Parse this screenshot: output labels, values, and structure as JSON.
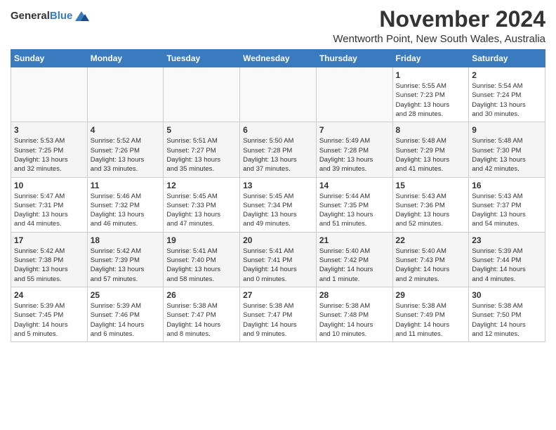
{
  "header": {
    "logo_general": "General",
    "logo_blue": "Blue",
    "month_title": "November 2024",
    "location": "Wentworth Point, New South Wales, Australia"
  },
  "days_of_week": [
    "Sunday",
    "Monday",
    "Tuesday",
    "Wednesday",
    "Thursday",
    "Friday",
    "Saturday"
  ],
  "weeks": [
    [
      {
        "day": "",
        "info": ""
      },
      {
        "day": "",
        "info": ""
      },
      {
        "day": "",
        "info": ""
      },
      {
        "day": "",
        "info": ""
      },
      {
        "day": "",
        "info": ""
      },
      {
        "day": "1",
        "info": "Sunrise: 5:55 AM\nSunset: 7:23 PM\nDaylight: 13 hours\nand 28 minutes."
      },
      {
        "day": "2",
        "info": "Sunrise: 5:54 AM\nSunset: 7:24 PM\nDaylight: 13 hours\nand 30 minutes."
      }
    ],
    [
      {
        "day": "3",
        "info": "Sunrise: 5:53 AM\nSunset: 7:25 PM\nDaylight: 13 hours\nand 32 minutes."
      },
      {
        "day": "4",
        "info": "Sunrise: 5:52 AM\nSunset: 7:26 PM\nDaylight: 13 hours\nand 33 minutes."
      },
      {
        "day": "5",
        "info": "Sunrise: 5:51 AM\nSunset: 7:27 PM\nDaylight: 13 hours\nand 35 minutes."
      },
      {
        "day": "6",
        "info": "Sunrise: 5:50 AM\nSunset: 7:28 PM\nDaylight: 13 hours\nand 37 minutes."
      },
      {
        "day": "7",
        "info": "Sunrise: 5:49 AM\nSunset: 7:28 PM\nDaylight: 13 hours\nand 39 minutes."
      },
      {
        "day": "8",
        "info": "Sunrise: 5:48 AM\nSunset: 7:29 PM\nDaylight: 13 hours\nand 41 minutes."
      },
      {
        "day": "9",
        "info": "Sunrise: 5:48 AM\nSunset: 7:30 PM\nDaylight: 13 hours\nand 42 minutes."
      }
    ],
    [
      {
        "day": "10",
        "info": "Sunrise: 5:47 AM\nSunset: 7:31 PM\nDaylight: 13 hours\nand 44 minutes."
      },
      {
        "day": "11",
        "info": "Sunrise: 5:46 AM\nSunset: 7:32 PM\nDaylight: 13 hours\nand 46 minutes."
      },
      {
        "day": "12",
        "info": "Sunrise: 5:45 AM\nSunset: 7:33 PM\nDaylight: 13 hours\nand 47 minutes."
      },
      {
        "day": "13",
        "info": "Sunrise: 5:45 AM\nSunset: 7:34 PM\nDaylight: 13 hours\nand 49 minutes."
      },
      {
        "day": "14",
        "info": "Sunrise: 5:44 AM\nSunset: 7:35 PM\nDaylight: 13 hours\nand 51 minutes."
      },
      {
        "day": "15",
        "info": "Sunrise: 5:43 AM\nSunset: 7:36 PM\nDaylight: 13 hours\nand 52 minutes."
      },
      {
        "day": "16",
        "info": "Sunrise: 5:43 AM\nSunset: 7:37 PM\nDaylight: 13 hours\nand 54 minutes."
      }
    ],
    [
      {
        "day": "17",
        "info": "Sunrise: 5:42 AM\nSunset: 7:38 PM\nDaylight: 13 hours\nand 55 minutes."
      },
      {
        "day": "18",
        "info": "Sunrise: 5:42 AM\nSunset: 7:39 PM\nDaylight: 13 hours\nand 57 minutes."
      },
      {
        "day": "19",
        "info": "Sunrise: 5:41 AM\nSunset: 7:40 PM\nDaylight: 13 hours\nand 58 minutes."
      },
      {
        "day": "20",
        "info": "Sunrise: 5:41 AM\nSunset: 7:41 PM\nDaylight: 14 hours\nand 0 minutes."
      },
      {
        "day": "21",
        "info": "Sunrise: 5:40 AM\nSunset: 7:42 PM\nDaylight: 14 hours\nand 1 minute."
      },
      {
        "day": "22",
        "info": "Sunrise: 5:40 AM\nSunset: 7:43 PM\nDaylight: 14 hours\nand 2 minutes."
      },
      {
        "day": "23",
        "info": "Sunrise: 5:39 AM\nSunset: 7:44 PM\nDaylight: 14 hours\nand 4 minutes."
      }
    ],
    [
      {
        "day": "24",
        "info": "Sunrise: 5:39 AM\nSunset: 7:45 PM\nDaylight: 14 hours\nand 5 minutes."
      },
      {
        "day": "25",
        "info": "Sunrise: 5:39 AM\nSunset: 7:46 PM\nDaylight: 14 hours\nand 6 minutes."
      },
      {
        "day": "26",
        "info": "Sunrise: 5:38 AM\nSunset: 7:47 PM\nDaylight: 14 hours\nand 8 minutes."
      },
      {
        "day": "27",
        "info": "Sunrise: 5:38 AM\nSunset: 7:47 PM\nDaylight: 14 hours\nand 9 minutes."
      },
      {
        "day": "28",
        "info": "Sunrise: 5:38 AM\nSunset: 7:48 PM\nDaylight: 14 hours\nand 10 minutes."
      },
      {
        "day": "29",
        "info": "Sunrise: 5:38 AM\nSunset: 7:49 PM\nDaylight: 14 hours\nand 11 minutes."
      },
      {
        "day": "30",
        "info": "Sunrise: 5:38 AM\nSunset: 7:50 PM\nDaylight: 14 hours\nand 12 minutes."
      }
    ]
  ]
}
